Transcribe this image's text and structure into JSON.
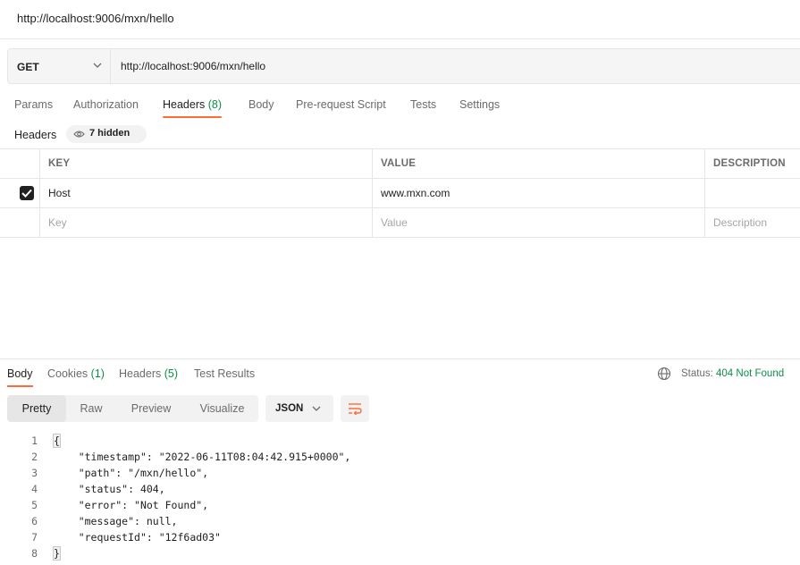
{
  "window_title": "http://localhost:9006/mxn/hello",
  "request": {
    "method": "GET",
    "url": "http://localhost:9006/mxn/hello"
  },
  "request_tabs": [
    {
      "label": "Params"
    },
    {
      "label": "Authorization"
    },
    {
      "label": "Headers",
      "count": "(8)"
    },
    {
      "label": "Body"
    },
    {
      "label": "Pre-request Script"
    },
    {
      "label": "Tests"
    },
    {
      "label": "Settings"
    }
  ],
  "headers_section": {
    "label": "Headers",
    "hidden_label": "7 hidden"
  },
  "table": {
    "columns": [
      "KEY",
      "VALUE",
      "DESCRIPTION"
    ],
    "rows": [
      {
        "checked": true,
        "key": "Host",
        "value": "www.mxn.com",
        "description": ""
      }
    ],
    "placeholders": {
      "key": "Key",
      "value": "Value",
      "description": "Description"
    }
  },
  "response_tabs": [
    {
      "label": "Body"
    },
    {
      "label": "Cookies",
      "count": "(1)"
    },
    {
      "label": "Headers",
      "count": "(5)"
    },
    {
      "label": "Test Results"
    }
  ],
  "status": {
    "label": "Status:",
    "code": "404",
    "text": "Not Found"
  },
  "view_modes": [
    "Pretty",
    "Raw",
    "Preview",
    "Visualize"
  ],
  "format": "JSON",
  "body_lines": [
    "{",
    "\"timestamp\": \"2022-06-11T08:04:42.915+0000\",",
    "\"path\": \"/mxn/hello\",",
    "\"status\": 404,",
    "\"error\": \"Not Found\",",
    "\"message\": null,",
    "\"requestId\": \"12f6ad03\"",
    "}"
  ],
  "colors": {
    "accent": "#ff6c37",
    "success": "#0c8f4a",
    "string": "#0b5394"
  }
}
